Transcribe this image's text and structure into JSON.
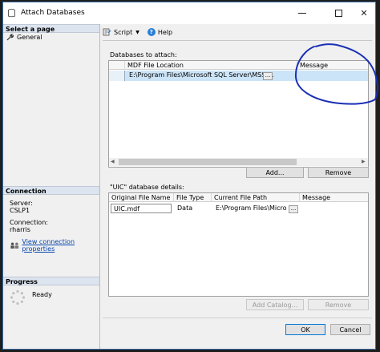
{
  "window": {
    "title": "Attach Databases"
  },
  "left_pane": {
    "select_page_header": "Select a page",
    "pages": [
      {
        "label": "General",
        "icon": "wrench-icon"
      }
    ],
    "connection_header": "Connection",
    "server_label": "Server:",
    "server_value": "CSLP1",
    "connection_label": "Connection:",
    "connection_value": "rharris",
    "view_connection_link": "View connection properties",
    "progress_header": "Progress",
    "progress_status": "Ready"
  },
  "toolbar": {
    "script_label": "Script",
    "help_label": "Help"
  },
  "attach_section": {
    "label": "Databases to attach:",
    "columns": [
      "MDF File Location",
      "Message"
    ],
    "rows": [
      {
        "mdf_location": "E:\\Program Files\\Microsoft SQL Server\\MSSQL...",
        "ellipsis": "...",
        "message": ""
      }
    ],
    "add_button": "Add...",
    "remove_button": "Remove"
  },
  "details_section": {
    "label": "\"UIC\" database details:",
    "columns": [
      "Original File Name",
      "File Type",
      "Current File Path",
      "Message"
    ],
    "rows": [
      {
        "original_name": "UIC.mdf",
        "file_type": "Data",
        "current_path": "E:\\Program Files\\Micros...",
        "ellipsis": "...",
        "message": ""
      }
    ],
    "add_catalog_button": "Add Catalog...",
    "remove_button": "Remove"
  },
  "footer": {
    "ok_button": "OK",
    "cancel_button": "Cancel"
  },
  "colors": {
    "annotation_ink": "#1a2fb5",
    "link": "#0645ad",
    "section_header_bg": "#dbe4ef",
    "selection": "#cce4f7"
  }
}
